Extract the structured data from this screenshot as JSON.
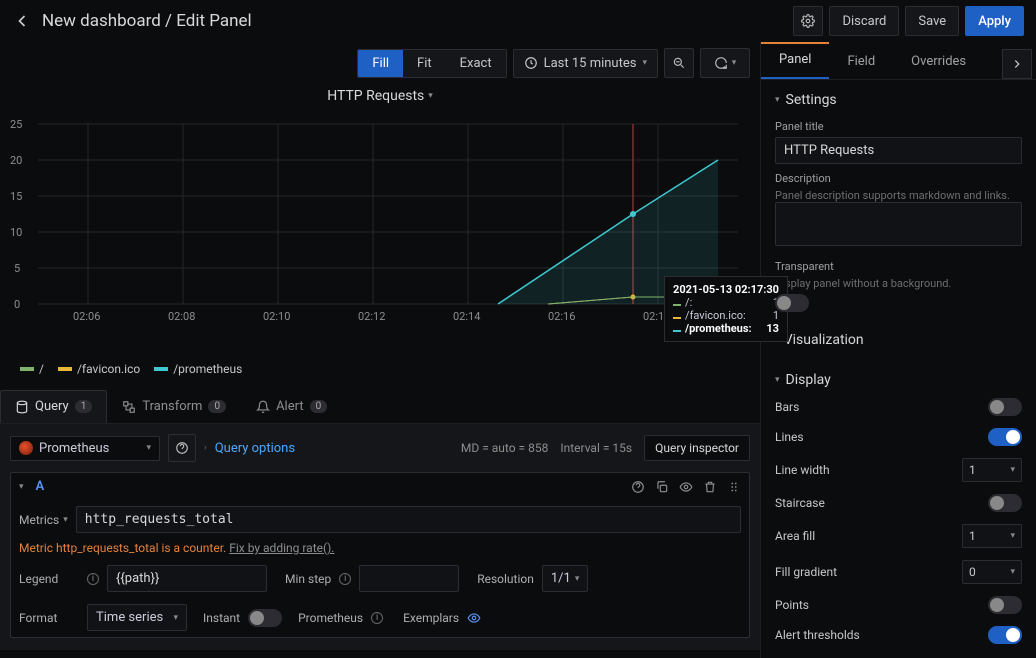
{
  "header": {
    "title": "New dashboard / Edit Panel",
    "discard": "Discard",
    "save": "Save",
    "apply": "Apply"
  },
  "toolbar": {
    "fill": "Fill",
    "fit": "Fit",
    "exact": "Exact",
    "time": "Last 15 minutes"
  },
  "panel": {
    "title": "HTTP Requests"
  },
  "chart_data": {
    "type": "line",
    "title": "HTTP Requests",
    "ylim": [
      0,
      25
    ],
    "y_ticks": [
      0,
      5,
      10,
      15,
      20,
      25
    ],
    "x_categories": [
      "02:06",
      "02:08",
      "02:10",
      "02:12",
      "02:14",
      "02:16",
      "02:18"
    ],
    "series": [
      {
        "name": "/",
        "color": "#7eb26d",
        "values": [
          null,
          null,
          null,
          null,
          null,
          1,
          1
        ]
      },
      {
        "name": "/favicon.ico",
        "color": "#eab839",
        "values": [
          null,
          null,
          null,
          null,
          null,
          1,
          1
        ]
      },
      {
        "name": "/prometheus",
        "color": "#3ec9d0",
        "values": [
          null,
          null,
          null,
          null,
          1,
          13,
          20
        ]
      }
    ],
    "cursor_x_label": "02:17",
    "tooltip": {
      "time": "2021-05-13 02:17:30",
      "rows": [
        {
          "label": "/:",
          "value": "1",
          "color": "#7eb26d"
        },
        {
          "label": "/favicon.ico:",
          "value": "1",
          "color": "#eab839"
        },
        {
          "label": "/prometheus:",
          "value": "13",
          "color": "#3ec9d0",
          "bold": true
        }
      ]
    }
  },
  "legend": [
    {
      "label": "/",
      "color": "#7eb26d"
    },
    {
      "label": "/favicon.ico",
      "color": "#eab839"
    },
    {
      "label": "/prometheus",
      "color": "#3ec9d0"
    }
  ],
  "qtabs": {
    "query": "Query",
    "query_badge": "1",
    "transform": "Transform",
    "transform_badge": "0",
    "alert": "Alert",
    "alert_badge": "0"
  },
  "datasource": {
    "name": "Prometheus",
    "query_options": "Query options",
    "meta1": "MD = auto = 858",
    "meta2": "Interval = 15s",
    "inspector": "Query inspector"
  },
  "query": {
    "letter": "A",
    "metrics_label": "Metrics",
    "metric_value": "http_requests_total",
    "warning_text": "Metric http_requests_total is a counter.",
    "warning_link": "Fix by adding rate().",
    "legend_label": "Legend",
    "legend_value": "{{path}}",
    "minstep_label": "Min step",
    "minstep_value": "",
    "resolution_label": "Resolution",
    "resolution_value": "1/1",
    "format_label": "Format",
    "format_value": "Time series",
    "instant_label": "Instant",
    "prom_label": "Prometheus",
    "exemplars_label": "Exemplars"
  },
  "rtabs": {
    "panel": "Panel",
    "field": "Field",
    "overrides": "Overrides"
  },
  "settings": {
    "heading": "Settings",
    "panel_title_label": "Panel title",
    "panel_title_value": "HTTP Requests",
    "desc_label": "Description",
    "desc_help": "Panel description supports markdown and links.",
    "desc_value": "",
    "transparent_label": "Transparent",
    "transparent_help": "Display panel without a background."
  },
  "viz": {
    "heading": "Visualization"
  },
  "display": {
    "heading": "Display",
    "bars": "Bars",
    "lines": "Lines",
    "line_width": "Line width",
    "line_width_val": "1",
    "staircase": "Staircase",
    "area_fill": "Area fill",
    "area_fill_val": "1",
    "fill_gradient": "Fill gradient",
    "fill_gradient_val": "0",
    "points": "Points",
    "alert_thresholds": "Alert thresholds"
  }
}
